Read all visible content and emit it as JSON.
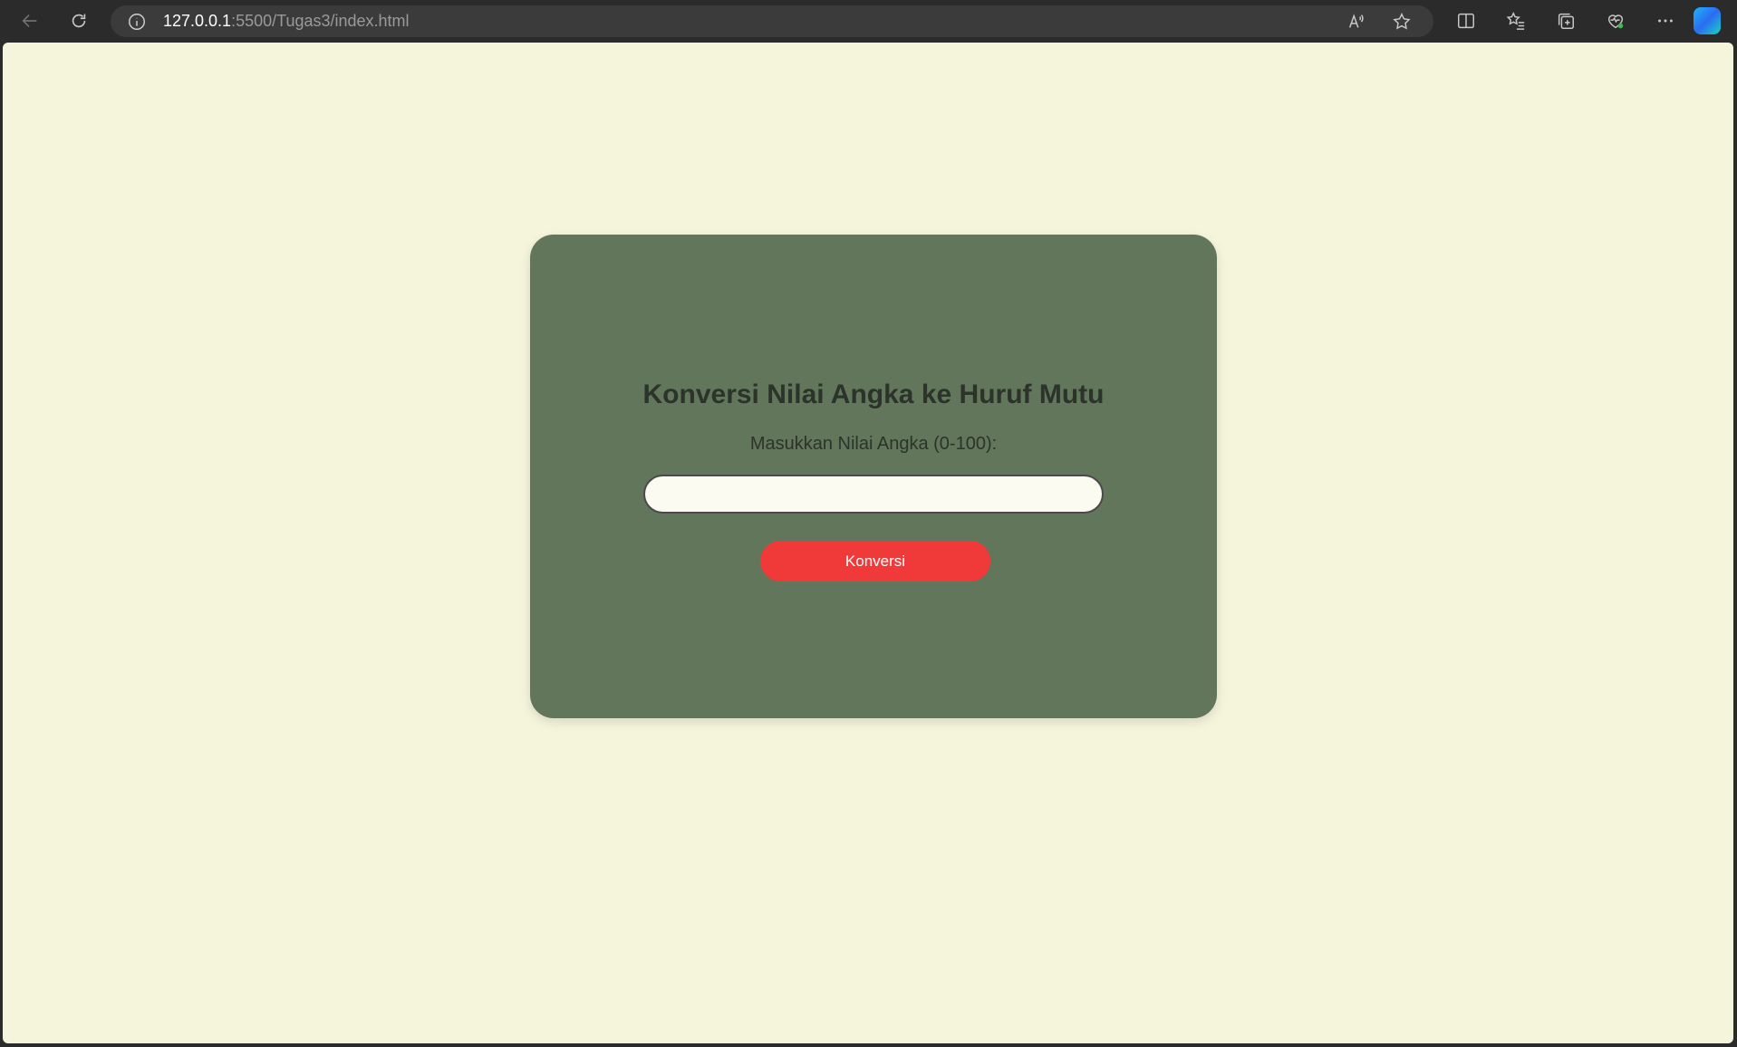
{
  "browser": {
    "url_host": "127.0.0.1",
    "url_rest": ":5500/Tugas3/index.html",
    "icons": {
      "back": "arrow-left-icon",
      "reload": "reload-icon",
      "info": "info-icon",
      "read_aloud": "read-aloud-icon",
      "favorite": "star-icon",
      "split": "split-screen-icon",
      "favorites": "favorites-list-icon",
      "collections": "collections-icon",
      "health": "browser-essentials-icon",
      "more": "more-icon",
      "copilot": "copilot-icon"
    }
  },
  "page": {
    "title": "Konversi Nilai Angka ke Huruf Mutu",
    "label": "Masukkan Nilai Angka (0-100):",
    "input_value": "",
    "button_label": "Konversi",
    "colors": {
      "background": "#f5f5dc",
      "card": "#61765b",
      "button": "#f03a3a"
    }
  }
}
